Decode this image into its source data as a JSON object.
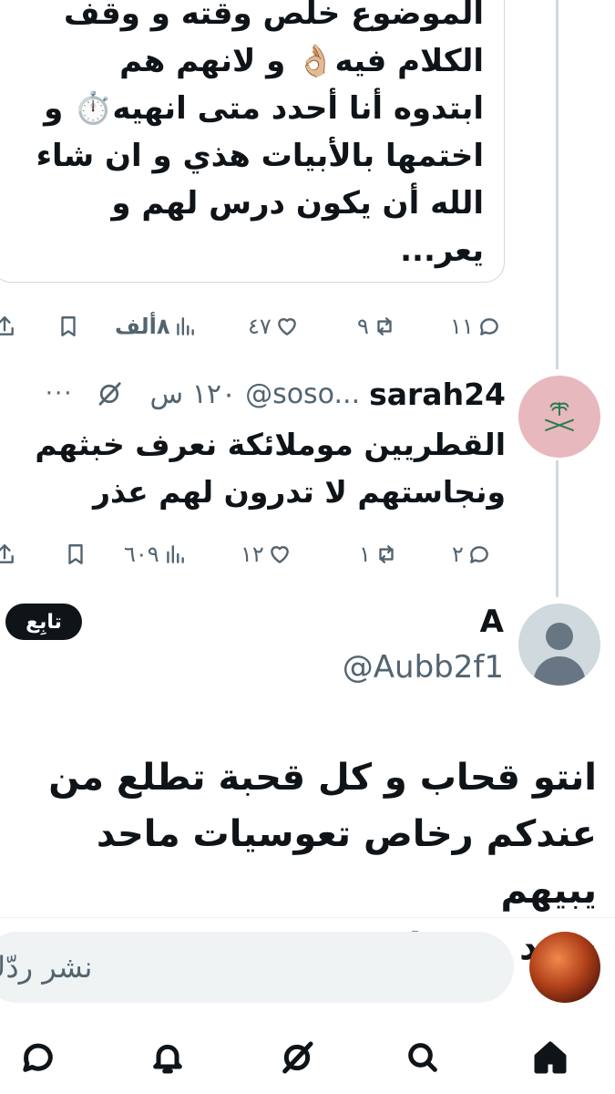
{
  "quoted_post": {
    "text_lines": [
      "الموضوع خلص وقته و وقف",
      "الكلام فيه👌🏼 و لانهم هم",
      "ابتدوه أنا أحدد متى انهيه⏱️ و",
      "اختمها بالأبيات هذي و ان شاء",
      "الله أن يكون درس لهم و يعر..."
    ],
    "stats": {
      "replies": "١١",
      "reposts": "٩",
      "likes": "٤٧",
      "views": "٨ألف"
    }
  },
  "reply_post": {
    "display_name": "sarah24",
    "handle": "@soso...",
    "time": "١٢٠ س",
    "text_lines": [
      "القطريين موملائكة نعرف خبثهم",
      "ونجاستهم لا تدرون لهم عذر"
    ],
    "stats": {
      "replies": "٢",
      "reposts": "١",
      "likes": "١٢",
      "views": "٦٠٩"
    }
  },
  "main_post": {
    "display_name": "A",
    "handle": "@Aubb2f1",
    "follow_label": "تابِع",
    "text_lines": [
      "انتو قحاب و كل قحبة تطلع من",
      "عندكم رخاص تعوسيات ماحد يبيهم",
      "سود وصخات"
    ]
  },
  "composer": {
    "placeholder": "نشر ردّك"
  },
  "more_label": "···",
  "bottom_nav": [
    "home-icon",
    "search-icon",
    "grok-icon",
    "notifications-icon",
    "messages-icon"
  ],
  "colors": {
    "text": "#0f1419",
    "muted": "#536471",
    "border": "#cfd9de",
    "avatar_pink": "#e8b8bf"
  }
}
